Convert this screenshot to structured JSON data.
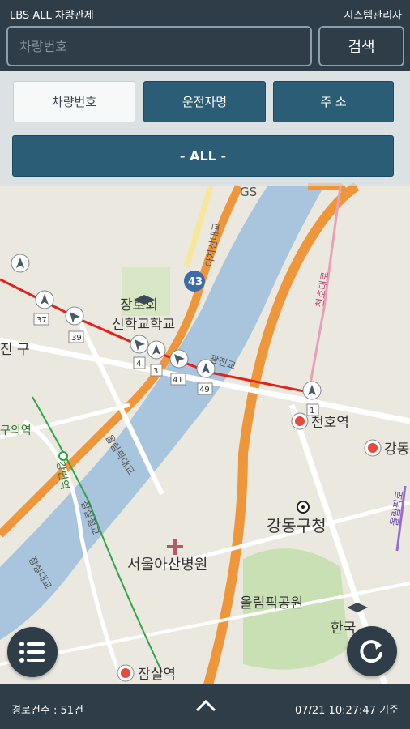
{
  "header": {
    "app_title": "LBS ALL 차량관제",
    "user_label": "시스템관리자"
  },
  "search": {
    "placeholder": "차량번호",
    "button_label": "검색"
  },
  "filter_tabs": [
    {
      "label": "차량번호",
      "active": true
    },
    {
      "label": "운전자명",
      "active": false
    },
    {
      "label": "주  소",
      "active": false
    }
  ],
  "all_filter": {
    "label": "- ALL -"
  },
  "map": {
    "labels": {
      "jangro_school": "장로회",
      "school_line2": "신학교학교",
      "gwangjin_district": "진 구",
      "cheonho_station": "천호역",
      "gangdong_gu_office": "강동구청",
      "gangdong_edge": "강동",
      "olympic_bridge": "올림픽대교",
      "seoul_asan": "서울아산병원",
      "olympic_park": "올림픽공원",
      "jamsil_station": "잠실역",
      "gangbyeon_station": "강변역",
      "jamsil_railbridge": "잠실철교",
      "jamsil_bridge": "잠실대교",
      "gueui_station": "구의역",
      "gwangjin_bridge": "광진교",
      "cheonho_bridge": "천호대교",
      "ajeon_bridge": "아차산대교",
      "cheonho_road": "천호대로",
      "road_43": "43",
      "gs": "GS",
      "korea_sports": "한국",
      "bus_route_right": "올림픽로"
    },
    "markers": [
      "37",
      "39",
      "4",
      "3",
      "41",
      "49",
      "1"
    ]
  },
  "icons": {
    "menu": "list-icon",
    "refresh": "refresh-icon",
    "expand": "chevron-up-icon"
  },
  "status": {
    "route_count": "경로건수 : 51건",
    "timestamp": "07/21 10:27:47 기준"
  },
  "colors": {
    "header_bg": "#2f3d48",
    "tab_active_bg": "#2c5d76",
    "route_line": "#e8201c",
    "river": "#a9c4dd",
    "highway": "#f0963a"
  }
}
